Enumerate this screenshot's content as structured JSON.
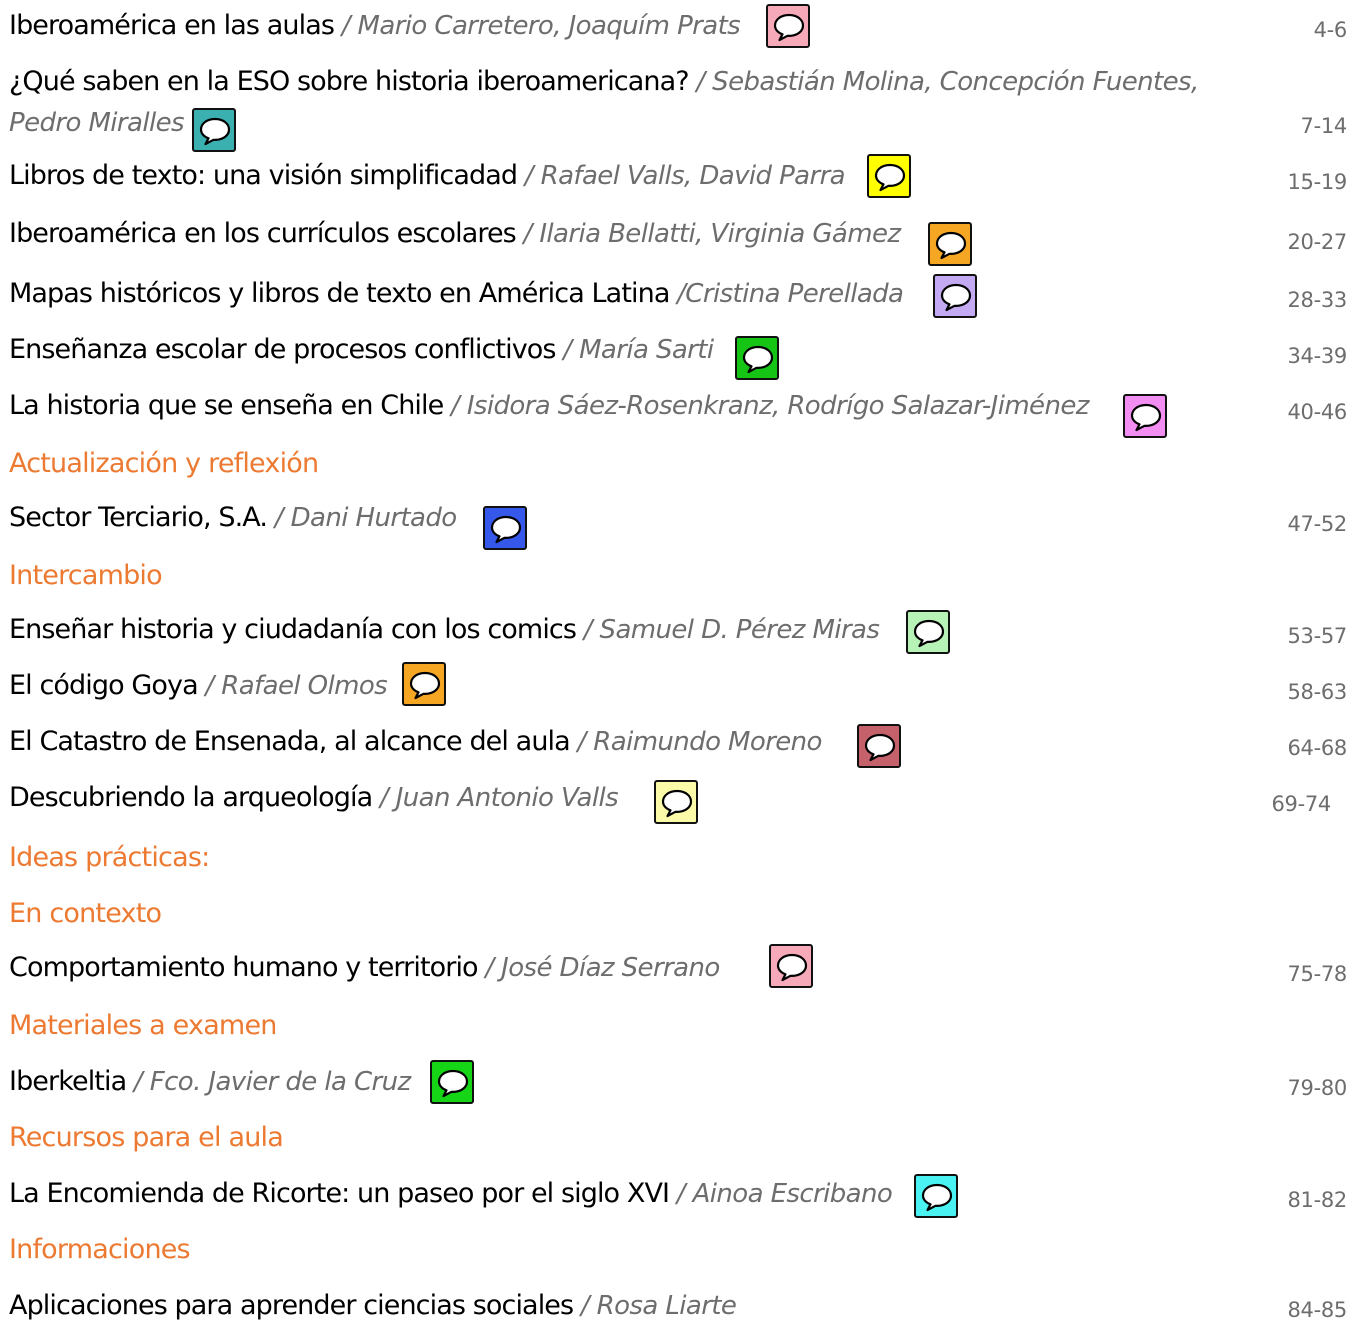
{
  "entries": [
    {
      "title": "Iberoamérica en las aulas",
      "author": " / Mario Carretero, Joaquím Prats",
      "pages": "4-6",
      "icon": "comment-icon",
      "color": "#f6a9b8"
    },
    {
      "title": "¿Qué saben en la ESO sobre historia iberoamericana?",
      "author_line1": " / Sebastián Molina, Concepción Fuentes,",
      "author_line2": "Pedro Miralles",
      "pages": "7-14",
      "icon": "comment-icon",
      "color": "#3ab0b0"
    },
    {
      "title": "Libros de texto: una visión simplificadad",
      "author": " / Rafael Valls, David Parra",
      "pages": "15-19",
      "icon": "comment-icon",
      "color": "#ffff00"
    },
    {
      "title": "Iberoamérica en los currículos escolares",
      "author": " / Ilaria Bellatti, Virginia Gámez",
      "pages": "20-27",
      "icon": "comment-icon",
      "color": "#f5a623"
    },
    {
      "title": "Mapas históricos y libros de texto en América Latina",
      "author": " /Cristina Perellada",
      "pages": "28-33",
      "icon": "comment-icon",
      "color": "#c3aaf2"
    },
    {
      "title": "Enseñanza escolar de procesos conflictivos",
      "author": " / María Sarti",
      "pages": "34-39",
      "icon": "comment-icon",
      "color": "#16c416"
    },
    {
      "title": "La historia que se enseña en Chile",
      "author": " / Isidora Sáez-Rosenkranz, Rodrígo Salazar-Jiménez",
      "pages": "40-46",
      "icon": "comment-icon",
      "color": "#f28ef2"
    },
    {
      "section": "Actualización y reflexión"
    },
    {
      "title": "Sector Terciario, S.A.",
      "author": " / Dani Hurtado",
      "pages": "47-52",
      "icon": "comment-icon",
      "color": "#3557ea"
    },
    {
      "section": "Intercambio"
    },
    {
      "title": "Enseñar historia y ciudadanía con los comics",
      "author": " / Samuel D. Pérez Miras",
      "pages": "53-57",
      "icon": "comment-icon",
      "color": "#b7f2b7"
    },
    {
      "title": "El código Goya",
      "author": " / Rafael Olmos",
      "pages": "58-63",
      "icon": "comment-icon",
      "color": "#f5a623"
    },
    {
      "title": "El  Catastro de Ensenada, al alcance del aula",
      "author": " / Raimundo Moreno",
      "pages": "64-68",
      "icon": "comment-icon",
      "color": "#c4616a"
    },
    {
      "title": "Descubriendo la arqueología",
      "author": " / Juan Antonio Valls",
      "pages": "69-74",
      "icon": "comment-icon",
      "color": "#fafaa8"
    },
    {
      "section": "Ideas prácticas:"
    },
    {
      "section": "En contexto"
    },
    {
      "title": "Comportamiento humano y territorio",
      "author": " / José Díaz Serrano",
      "pages": "75-78",
      "icon": "comment-icon",
      "color": "#f6a9b8"
    },
    {
      "section": "Materiales a examen"
    },
    {
      "title": "Iberkeltia",
      "author": " / Fco. Javier de la Cruz",
      "pages": "79-80",
      "icon": "comment-icon",
      "color": "#16d416"
    },
    {
      "section": "Recursos para el aula"
    },
    {
      "title": "La Encomienda de Ricorte:  un paseo por el siglo XVI",
      "author": " / Ainoa Escribano",
      "pages": "81-82",
      "icon": "comment-icon",
      "color": "#4af2f2"
    },
    {
      "section": "Informaciones"
    },
    {
      "title": "Aplicaciones para aprender ciencias sociales",
      "author": " / Rosa Liarte",
      "pages": "84-85"
    }
  ]
}
